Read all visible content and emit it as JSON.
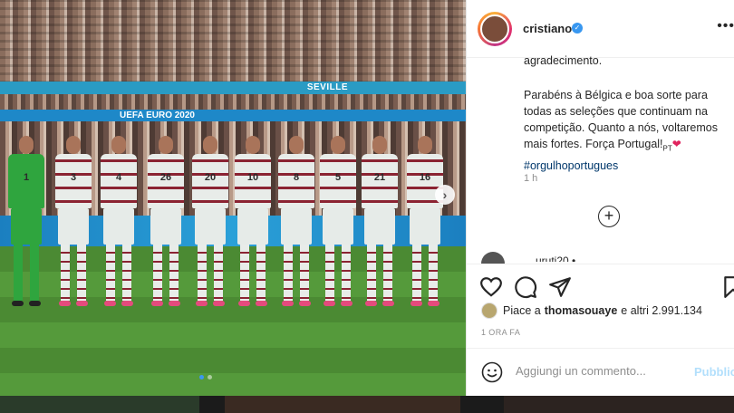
{
  "photo": {
    "banner_top": "SEVILLE",
    "banner_bottom": "UEFA EURO 2020",
    "players": [
      "1",
      "3",
      "4",
      "26",
      "20",
      "10",
      "8",
      "5",
      "21",
      "16"
    ],
    "carousel_dots": 2,
    "carousel_active": 0
  },
  "post": {
    "username": "cristiano",
    "verified_mark": "✓",
    "more_label": "•••",
    "caption_prev": "agradecimento.",
    "caption_text": "Parabéns à Bélgica e boa sorte para todas as seleções que continuam na competição. Quanto a nós, voltaremos mais fortes. Força Portugal!",
    "caption_flag": "PT",
    "caption_heart": "❤",
    "caption_hashtag": "#orgulhoportugues",
    "time_ago": "1 h",
    "load_more": "+",
    "comment_peek": "...uruti20 •"
  },
  "actions": {
    "icons": [
      "heart-icon",
      "comment-icon",
      "share-icon",
      "bookmark-icon"
    ]
  },
  "likes": {
    "prefix": "Piace a",
    "user": "thomasouaye",
    "suffix": "e altri 2.991.134"
  },
  "date": "1 ORA FA",
  "comment": {
    "placeholder": "Aggiungi un commento...",
    "publish": "Pubblica"
  },
  "colors": {
    "verified": "#3897f0",
    "hashtag": "#00376b",
    "publish": "#b2dffc"
  }
}
